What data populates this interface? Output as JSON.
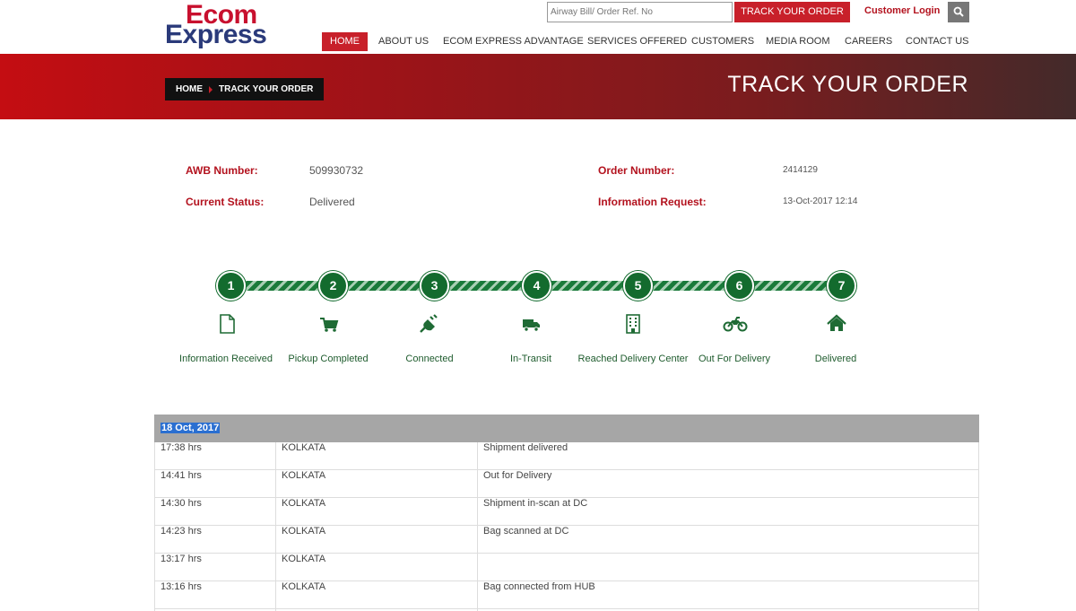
{
  "logo": {
    "line1": "Ecom",
    "line2": "Express"
  },
  "header": {
    "search_placeholder": "Airway Bill/ Order Ref. No",
    "track_button": "TRACK YOUR ORDER",
    "login_link": "Customer Login"
  },
  "nav": {
    "items": [
      {
        "label": "HOME"
      },
      {
        "label": "ABOUT US"
      },
      {
        "label": "ECOM EXPRESS ADVANTAGE"
      },
      {
        "label": "SERVICES OFFERED"
      },
      {
        "label": "CUSTOMERS"
      },
      {
        "label": "MEDIA ROOM"
      },
      {
        "label": "CAREERS"
      },
      {
        "label": "CONTACT US"
      }
    ]
  },
  "banner": {
    "breadcrumb_home": "HOME",
    "breadcrumb_current": "TRACK YOUR ORDER",
    "title": "TRACK YOUR ORDER"
  },
  "info": {
    "awb_label": "AWB Number:",
    "awb_value": "509930732",
    "status_label": "Current Status:",
    "status_value": "Delivered",
    "order_label": "Order Number:",
    "order_value": "2414129",
    "request_label": "Information Request:",
    "request_value": "13-Oct-2017 12:14"
  },
  "steps": [
    {
      "number": "1",
      "label": "Information Received",
      "icon": "file-icon"
    },
    {
      "number": "2",
      "label": "Pickup Completed",
      "icon": "cart-icon"
    },
    {
      "number": "3",
      "label": "Connected",
      "icon": "plug-icon"
    },
    {
      "number": "4",
      "label": "In-Transit",
      "icon": "truck-icon"
    },
    {
      "number": "5",
      "label": "Reached Delivery Center",
      "icon": "building-icon"
    },
    {
      "number": "6",
      "label": "Out For Delivery",
      "icon": "motorcycle-icon"
    },
    {
      "number": "7",
      "label": "Delivered",
      "icon": "home-icon"
    }
  ],
  "table": {
    "date": "18 Oct, 2017",
    "rows": [
      {
        "time": "17:38 hrs",
        "location": "KOLKATA",
        "status": "Shipment delivered"
      },
      {
        "time": "14:41 hrs",
        "location": "KOLKATA",
        "status": "Out for Delivery"
      },
      {
        "time": "14:30 hrs",
        "location": "KOLKATA",
        "status": "Shipment in-scan at DC"
      },
      {
        "time": "14:23 hrs",
        "location": "KOLKATA",
        "status": "Bag scanned at DC"
      },
      {
        "time": "13:17 hrs",
        "location": "KOLKATA",
        "status": ""
      },
      {
        "time": "13:16 hrs",
        "location": "KOLKATA",
        "status": "Bag connected from HUB"
      },
      {
        "time": "",
        "location": "",
        "status": ""
      }
    ]
  },
  "colors": {
    "brand_red": "#c8202a",
    "brand_navy": "#2a3a7a",
    "step_green": "#136b2e"
  }
}
